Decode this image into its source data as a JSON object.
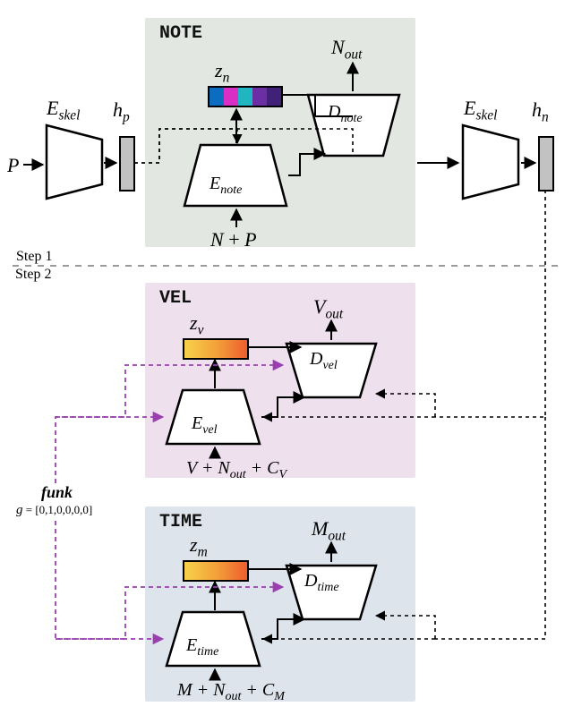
{
  "chart_data": {
    "type": "diagram",
    "steps": [
      "Step 1",
      "Step 2"
    ],
    "modules": [
      {
        "name": "NOTE",
        "encoder": "E_note",
        "decoder": "D_note",
        "latent": "z_n",
        "output": "N_out",
        "inputs": "N + P"
      },
      {
        "name": "VEL",
        "encoder": "E_vel",
        "decoder": "D_vel",
        "latent": "z_v",
        "output": "V_out",
        "inputs": "V + N_out + C_V"
      },
      {
        "name": "TIME",
        "encoder": "E_time",
        "decoder": "D_time",
        "latent": "z_m",
        "output": "M_out",
        "inputs": "M + N_out + C_M"
      }
    ],
    "skeleton_encoders": [
      {
        "name": "E_skel",
        "input": "P",
        "output": "h_p"
      },
      {
        "name": "E_skel",
        "output": "h_n"
      }
    ],
    "condition": {
      "label": "funk",
      "vector": "g = [0,1,0,0,0,0]"
    }
  },
  "labels": {
    "note_title": "NOTE",
    "vel_title": "VEL",
    "time_title": "TIME",
    "step1": "Step 1",
    "step2": "Step 2",
    "P": "P",
    "E_skel": "E",
    "skel_sub": "skel",
    "h_p": "h",
    "h_p_sub": "p",
    "h_n": "h",
    "h_n_sub": "n",
    "z_n": "z",
    "z_n_sub": "n",
    "z_v": "z",
    "z_v_sub": "v",
    "z_m": "z",
    "z_m_sub": "m",
    "E_note": "E",
    "note_sub": "note",
    "D_note": "D",
    "N_out": "N",
    "out_sub": "out",
    "note_inputs_N": "N",
    "note_inputs_plus": " + ",
    "note_inputs_P": "P",
    "E_vel": "E",
    "vel_sub": "vel",
    "D_vel": "D",
    "V_out": "V",
    "vel_inputs": "V + N",
    "vel_inputs_Cv": "+ C",
    "V_sub": "V",
    "E_time": "E",
    "time_sub": "time",
    "D_time": "D",
    "M_out": "M",
    "time_inputs": "M + N",
    "time_inputs_Cm": "+ C",
    "M_sub": "M",
    "funk": "funk",
    "g": "g",
    "g_eq": " = [0,1,0,0,0,0]"
  }
}
